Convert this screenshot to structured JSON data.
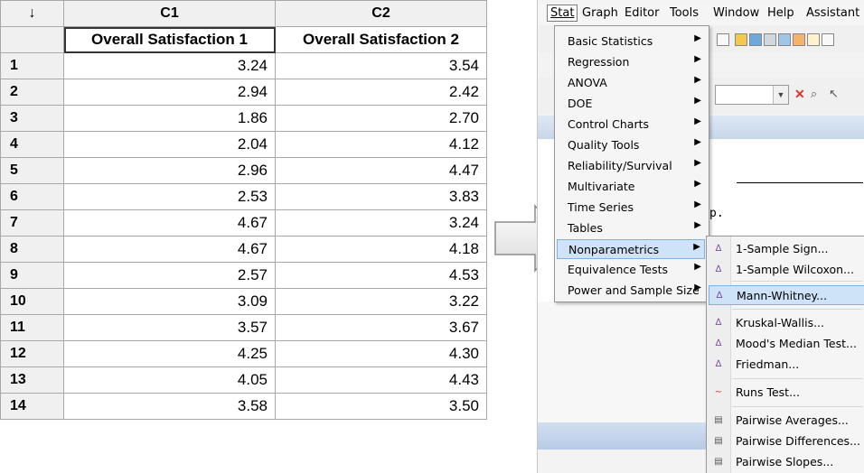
{
  "worksheet": {
    "corner_symbol": "↓",
    "columns": [
      "C1",
      "C2"
    ],
    "column_names": [
      "Overall Satisfaction 1",
      "Overall Satisfaction 2"
    ],
    "rows": [
      {
        "n": "1",
        "c1": "3.24",
        "c2": "3.54"
      },
      {
        "n": "2",
        "c1": "2.94",
        "c2": "2.42"
      },
      {
        "n": "3",
        "c1": "1.86",
        "c2": "2.70"
      },
      {
        "n": "4",
        "c1": "2.04",
        "c2": "4.12"
      },
      {
        "n": "5",
        "c1": "2.96",
        "c2": "4.47"
      },
      {
        "n": "6",
        "c1": "2.53",
        "c2": "3.83"
      },
      {
        "n": "7",
        "c1": "4.67",
        "c2": "3.24"
      },
      {
        "n": "8",
        "c1": "4.67",
        "c2": "4.18"
      },
      {
        "n": "9",
        "c1": "2.57",
        "c2": "4.53"
      },
      {
        "n": "10",
        "c1": "3.09",
        "c2": "3.22"
      },
      {
        "n": "11",
        "c1": "3.57",
        "c2": "3.67"
      },
      {
        "n": "12",
        "c1": "4.25",
        "c2": "4.30"
      },
      {
        "n": "13",
        "c1": "4.05",
        "c2": "4.43"
      },
      {
        "n": "14",
        "c1": "3.58",
        "c2": "3.50"
      }
    ]
  },
  "menubar": {
    "items": [
      "Stat",
      "Graph",
      "Editor",
      "Tools",
      "Window",
      "Help",
      "Assistant"
    ]
  },
  "stat_menu": {
    "items": [
      {
        "label": "Basic Statistics"
      },
      {
        "label": "Regression"
      },
      {
        "label": "ANOVA"
      },
      {
        "label": "DOE"
      },
      {
        "label": "Control Charts"
      },
      {
        "label": "Quality Tools"
      },
      {
        "label": "Reliability/Survival"
      },
      {
        "label": "Multivariate"
      },
      {
        "label": "Time Series"
      },
      {
        "label": "Tables"
      },
      {
        "label": "Nonparametrics"
      },
      {
        "label": "Equivalence Tests"
      },
      {
        "label": "Power and Sample Size"
      }
    ],
    "highlighted": "Nonparametrics"
  },
  "nonparametrics_menu": {
    "items": [
      {
        "label": "1-Sample Sign..."
      },
      {
        "label": "1-Sample Wilcoxon..."
      },
      {
        "label": "Mann-Whitney..."
      },
      {
        "label": "Kruskal-Wallis..."
      },
      {
        "label": "Mood's Median Test..."
      },
      {
        "label": "Friedman..."
      },
      {
        "label": "Runs Test..."
      },
      {
        "label": "Pairwise Averages..."
      },
      {
        "label": "Pairwise Differences..."
      },
      {
        "label": "Pairwise Slopes..."
      }
    ],
    "highlighted": "Mann-Whitney..."
  },
  "session": {
    "partial_text": "p."
  },
  "colors": {
    "highlight": "#cfe3f8",
    "highlight_border": "#84aedb",
    "menu_bg": "#f5f5f5"
  }
}
